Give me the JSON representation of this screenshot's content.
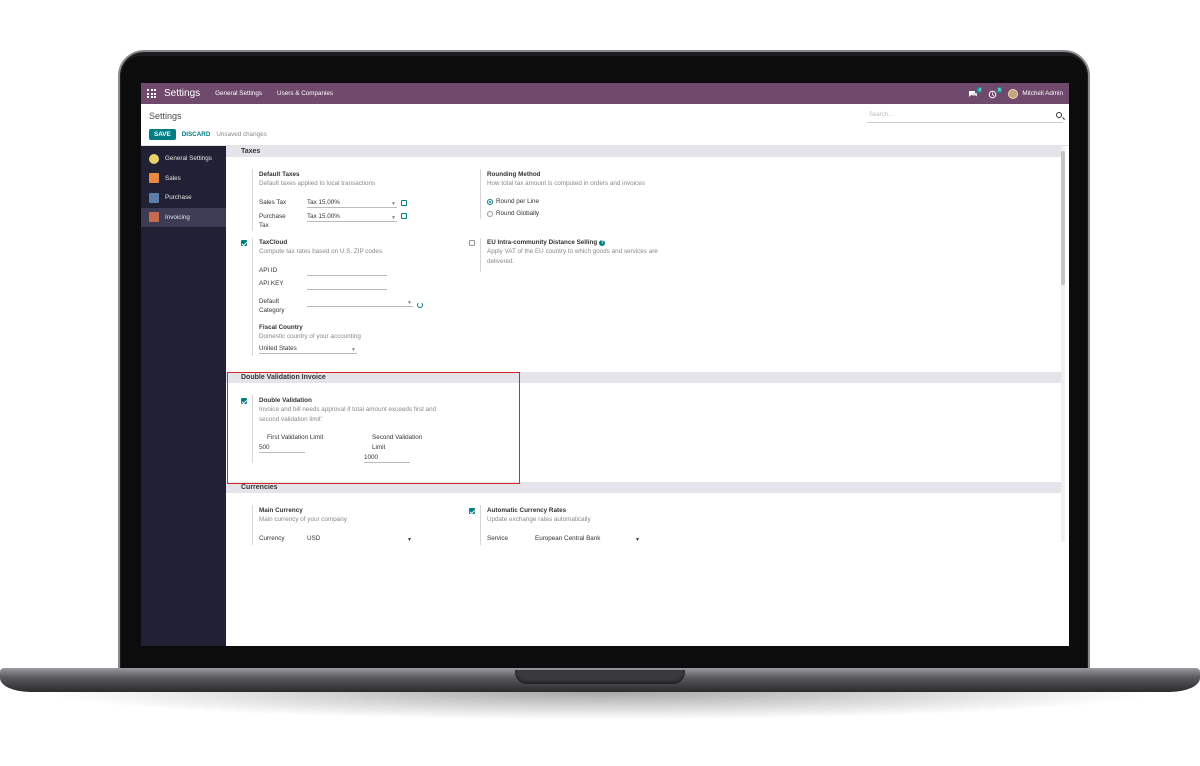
{
  "navbar": {
    "app_title": "Settings",
    "menu": [
      "General Settings",
      "Users & Companies"
    ],
    "messages_badge": "4",
    "activities_badge": "5",
    "user_name": "Mitchell Admin"
  },
  "control_panel": {
    "breadcrumb": "Settings",
    "save_label": "SAVE",
    "discard_label": "DISCARD",
    "unsaved": "Unsaved changes",
    "search_placeholder": "Search..."
  },
  "sidebar": {
    "items": [
      {
        "label": "General Settings",
        "icon": "gear-icon"
      },
      {
        "label": "Sales",
        "icon": "sales-chart-icon"
      },
      {
        "label": "Purchase",
        "icon": "purchase-icon"
      },
      {
        "label": "Invoicing",
        "icon": "invoice-icon",
        "active": true
      }
    ]
  },
  "taxes": {
    "header": "Taxes",
    "default_taxes": {
      "title": "Default Taxes",
      "desc": "Default taxes applied to local transactions",
      "sales_tax_label": "Sales Tax",
      "sales_tax_value": "Tax 15.00%",
      "purchase_tax_label_1": "Purchase",
      "purchase_tax_label_2": "Tax",
      "purchase_tax_value": "Tax 15.00%"
    },
    "rounding": {
      "title": "Rounding Method",
      "desc": "How total tax amount is computed in orders and invoices",
      "options": [
        "Round per Line",
        "Round Globally"
      ],
      "selected": "Round per Line"
    },
    "taxcloud": {
      "title": "TaxCloud",
      "desc": "Compute tax rates based on U.S. ZIP codes",
      "checked": true,
      "api_id_label": "API ID",
      "api_key_label": "API KEY",
      "default_category_label_1": "Default",
      "default_category_label_2": "Category"
    },
    "eu": {
      "title": "EU Intra-community Distance Selling",
      "desc_1": "Apply VAT of the EU country to which goods and services are",
      "desc_2": "delivered.",
      "checked": false
    },
    "fiscal": {
      "title": "Fiscal Country",
      "desc": "Domestic country of your accounting",
      "value": "United States"
    }
  },
  "double_validation": {
    "header": "Double Validation Invoice",
    "title": "Double Validation",
    "desc_1": "Invoice and bill needs approval if total amount exceeds first and",
    "desc_2": "second validation limit'",
    "checked": true,
    "first_label": "First Validation Limit",
    "first_value": "500",
    "second_label_1": "Second Validation",
    "second_label_2": "Limit",
    "second_value": "1000"
  },
  "currencies": {
    "header": "Currencies",
    "main": {
      "title": "Main Currency",
      "desc": "Main currency of your company",
      "field_label": "Currency",
      "value": "USD"
    },
    "auto": {
      "title": "Automatic Currency Rates",
      "desc": "Update exchange rates automatically",
      "checked": true,
      "field_label": "Service",
      "value": "European Central Bank"
    }
  },
  "colors": {
    "navbar": "#6f4a6c",
    "primary": "#017e84",
    "sidebar": "#212135",
    "highlight": "#d4262b"
  }
}
